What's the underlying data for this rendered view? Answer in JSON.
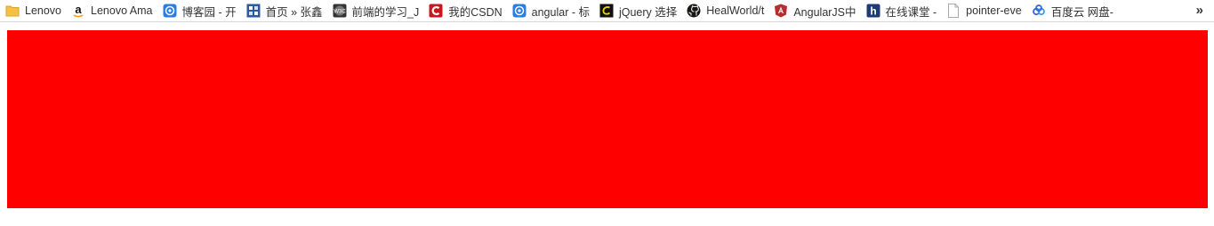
{
  "bookmarks": [
    {
      "label": "Lenovo",
      "icon": "folder-icon",
      "color": "#f5c143"
    },
    {
      "label": "Lenovo Ama",
      "icon": "amazon-icon",
      "color": "#ff9900"
    },
    {
      "label": "博客园 - 开",
      "icon": "cnblogs-icon",
      "color": "#2a7de1"
    },
    {
      "label": "首页 » 张鑫",
      "icon": "site-grid-icon",
      "color": "#2c5aa0"
    },
    {
      "label": "前端的学习_J",
      "icon": "w3c-icon",
      "color": "#333333"
    },
    {
      "label": "我的CSDN",
      "icon": "csdn-icon",
      "color": "#c9171e"
    },
    {
      "label": "angular - 标",
      "icon": "cnblogs-icon",
      "color": "#2a7de1"
    },
    {
      "label": "jQuery 选择",
      "icon": "jquery-icon",
      "color": "#111111"
    },
    {
      "label": "HealWorld/t",
      "icon": "github-icon",
      "color": "#161614"
    },
    {
      "label": "AngularJS中",
      "icon": "angularjs-icon",
      "color": "#b52e31"
    },
    {
      "label": "在线课堂 -",
      "icon": "hui-icon",
      "color": "#1f3b73"
    },
    {
      "label": "pointer-eve",
      "icon": "blank-page-icon",
      "color": "#bbbbbb"
    },
    {
      "label": "百度云 网盘-",
      "icon": "baidu-cloud-icon",
      "color": "#2f6bd9"
    }
  ],
  "overflow_label": "»",
  "content": {
    "box_color": "#ff0000"
  }
}
